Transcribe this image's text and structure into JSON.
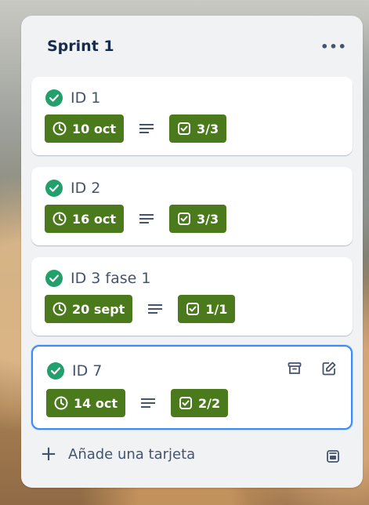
{
  "list": {
    "title": "Sprint 1",
    "menu_icon": "more-horizontal-icon",
    "add_card_label": "Añade una tarjeta",
    "add_icon": "plus-icon",
    "template_icon": "card-template-icon"
  },
  "colors": {
    "badge_green": "#4a7a1c",
    "check_green": "#22a06b",
    "active_border": "#388bff"
  },
  "cards": [
    {
      "title": "ID 1",
      "date": "10 oct",
      "checklist": "3/3",
      "completed": true
    },
    {
      "title": "ID 2",
      "date": "16 oct",
      "checklist": "3/3",
      "completed": true
    },
    {
      "title": "ID 3 fase 1",
      "date": "20 sept",
      "checklist": "1/1",
      "completed": true
    },
    {
      "title": "ID 7",
      "date": "14 oct",
      "checklist": "2/2",
      "completed": true,
      "hovered": true,
      "actions": [
        "archive-icon",
        "edit-icon"
      ]
    }
  ]
}
